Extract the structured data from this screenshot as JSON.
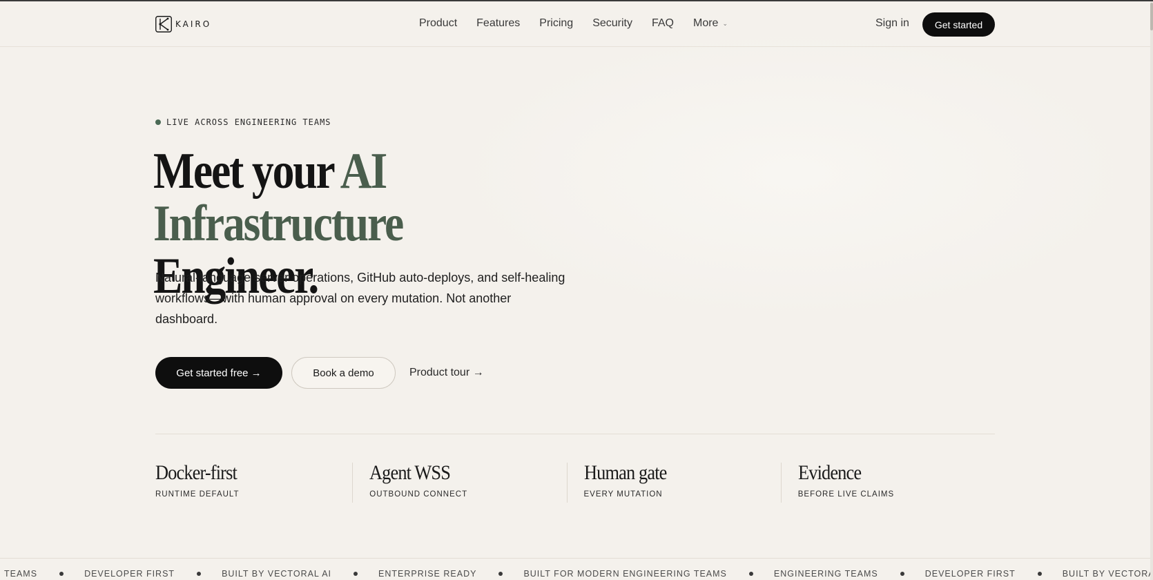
{
  "brand": {
    "name": "KAIRO"
  },
  "nav": {
    "items": [
      {
        "label": "Product"
      },
      {
        "label": "Features"
      },
      {
        "label": "Pricing"
      },
      {
        "label": "Security"
      },
      {
        "label": "FAQ"
      },
      {
        "label": "More"
      }
    ],
    "sign_in": "Sign in",
    "get_started": "Get started"
  },
  "hero": {
    "eyebrow": "LIVE ACROSS ENGINEERING TEAMS",
    "headline_part1": "Meet your ",
    "headline_accent": "AI Infrastructure",
    "headline_part2": "Engineer.",
    "subtext": "Natural-language server operations, GitHub auto-deploys, and self-healing workflows—with human approval on every mutation. Not another dashboard.",
    "cta_primary": "Get started free →",
    "cta_secondary": "Book a demo",
    "cta_link": "Product tour →"
  },
  "stats": [
    {
      "title": "Docker-first",
      "sub": "RUNTIME DEFAULT"
    },
    {
      "title": "Agent WSS",
      "sub": "OUTBOUND CONNECT"
    },
    {
      "title": "Human gate",
      "sub": "EVERY MUTATION"
    },
    {
      "title": "Evidence",
      "sub": "BEFORE LIVE CLAIMS"
    }
  ],
  "ticker": [
    "TEAMS",
    "DEVELOPER FIRST",
    "BUILT BY VECTORAL AI",
    "ENTERPRISE READY",
    "BUILT FOR MODERN ENGINEERING TEAMS",
    "ENGINEERING TEAMS",
    "DEVELOPER FIRST",
    "BUILT BY VECTORAL AI"
  ],
  "colors": {
    "background": "#f5f2ed",
    "accent": "#4a5e4d",
    "primary_button": "#0e0e0e",
    "status_dot": "#4a6a55"
  }
}
